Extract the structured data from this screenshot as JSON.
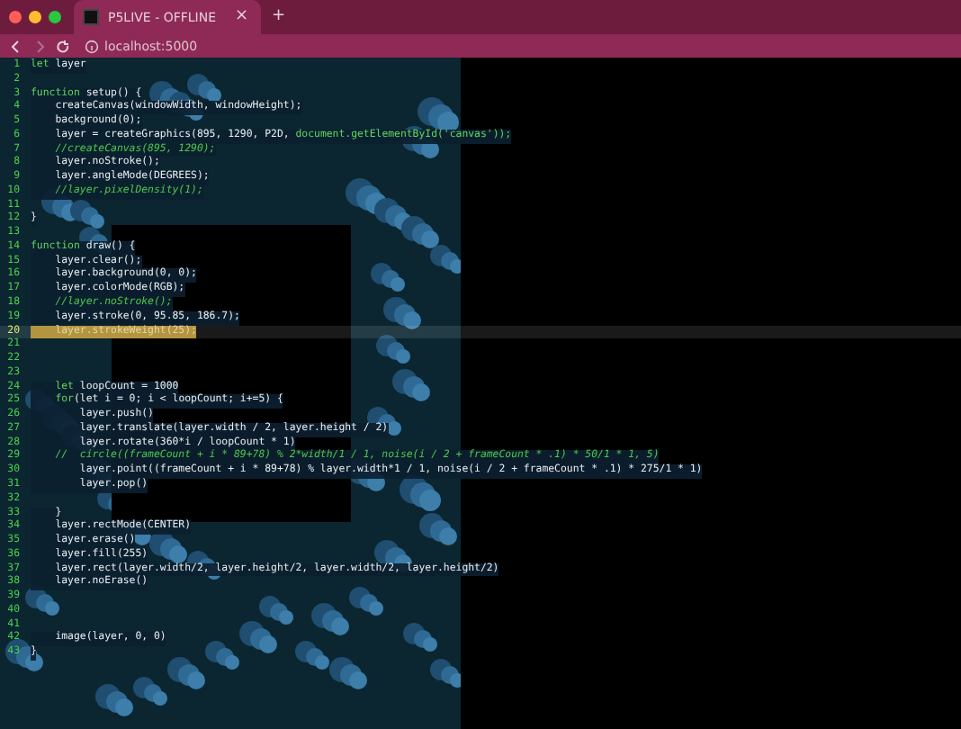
{
  "tabs": [
    {
      "title": "P5LIVE - OFFLINE",
      "selected": true,
      "close": "×"
    }
  ],
  "new_tab": "+",
  "address_bar": {
    "url": "localhost:5000"
  },
  "editor": {
    "lines": [
      {
        "number": "1",
        "current": false,
        "segments": [
          {
            "text": "let",
            "kind": "keyword"
          },
          {
            "text": " layer",
            "kind": "code"
          }
        ]
      },
      {
        "number": "2",
        "current": false
      },
      {
        "number": "3",
        "current": false,
        "segments": [
          {
            "text": "function",
            "kind": "keyword"
          },
          {
            "text": " setup() {",
            "kind": "code"
          }
        ]
      },
      {
        "number": "4",
        "current": false,
        "segments": [
          {
            "text": "    createCanvas(windowWidth, windowHeight);",
            "kind": "code"
          }
        ]
      },
      {
        "number": "5",
        "current": false,
        "segments": [
          {
            "text": "    background(0);",
            "kind": "code"
          }
        ]
      },
      {
        "number": "6",
        "current": false,
        "segments": [
          {
            "text": "    layer = createGraphics(895, 1290, P2D, ",
            "kind": "code"
          },
          {
            "text": "document.getElementById('canvas'));",
            "kind": "keyword"
          }
        ]
      },
      {
        "number": "7",
        "current": false,
        "segments": [
          {
            "text": "    //createCanvas(895, 1290);",
            "kind": "comment"
          }
        ]
      },
      {
        "number": "8",
        "current": false,
        "segments": [
          {
            "text": "    layer.noStroke();",
            "kind": "code"
          }
        ]
      },
      {
        "number": "9",
        "current": false,
        "segments": [
          {
            "text": "    layer.angleMode(DEGREES);",
            "kind": "code"
          }
        ]
      },
      {
        "number": "10",
        "current": false,
        "segments": [
          {
            "text": "    //layer.pixelDensity(1);",
            "kind": "comment"
          }
        ]
      },
      {
        "number": "11",
        "current": false
      },
      {
        "number": "12",
        "current": false,
        "segments": [
          {
            "text": "}",
            "kind": "code"
          }
        ]
      },
      {
        "number": "13",
        "current": false
      },
      {
        "number": "14",
        "current": false,
        "segments": [
          {
            "text": "function",
            "kind": "keyword"
          },
          {
            "text": " draw() {",
            "kind": "code"
          }
        ]
      },
      {
        "number": "15",
        "current": false,
        "segments": [
          {
            "text": "    layer.clear();",
            "kind": "code"
          }
        ]
      },
      {
        "number": "16",
        "current": false,
        "segments": [
          {
            "text": "    layer.background(0, 0);",
            "kind": "code"
          }
        ]
      },
      {
        "number": "17",
        "current": false,
        "segments": [
          {
            "text": "    layer.colorMode(RGB);",
            "kind": "code"
          }
        ]
      },
      {
        "number": "18",
        "current": false,
        "segments": [
          {
            "text": "    //layer.noStroke();",
            "kind": "comment"
          }
        ]
      },
      {
        "number": "19",
        "current": false,
        "segments": [
          {
            "text": "    layer.stroke(0, 95.85, 186.7);",
            "kind": "code"
          }
        ]
      },
      {
        "number": "20",
        "current": true,
        "segments": [
          {
            "text": "    layer.strokeWeight(25);",
            "kind": "code"
          }
        ]
      },
      {
        "number": "21",
        "current": false
      },
      {
        "number": "22",
        "current": false
      },
      {
        "number": "23",
        "current": false
      },
      {
        "number": "24",
        "current": false,
        "segments": [
          {
            "text": "    let",
            "kind": "keyword"
          },
          {
            "text": " loopCount = 1000",
            "kind": "code"
          }
        ]
      },
      {
        "number": "25",
        "current": false,
        "segments": [
          {
            "text": "    for",
            "kind": "keyword"
          },
          {
            "text": "(let i = 0; i < loopCount; i+=5) {",
            "kind": "code"
          }
        ]
      },
      {
        "number": "26",
        "current": false,
        "segments": [
          {
            "text": "        layer.push()",
            "kind": "code"
          }
        ]
      },
      {
        "number": "27",
        "current": false,
        "segments": [
          {
            "text": "        layer.translate(layer.width / 2, layer.height / 2)",
            "kind": "code"
          }
        ]
      },
      {
        "number": "28",
        "current": false,
        "segments": [
          {
            "text": "        layer.rotate(360*i / loopCount * 1)",
            "kind": "code"
          }
        ]
      },
      {
        "number": "29",
        "current": false,
        "segments": [
          {
            "text": "    //  circle((frameCount + i * 89+78) % 2*width/1 / 1, noise(i / 2 + frameCount * .1) * 50/1 * 1, 5)",
            "kind": "comment"
          }
        ]
      },
      {
        "number": "30",
        "current": false,
        "segments": [
          {
            "text": "        layer.point((frameCount + i * 89+78) % layer.width*1 / 1, noise(i / 2 + frameCount * .1) * 275/1 * 1)",
            "kind": "code"
          }
        ]
      },
      {
        "number": "31",
        "current": false,
        "segments": [
          {
            "text": "        layer.pop()",
            "kind": "code"
          }
        ]
      },
      {
        "number": "32",
        "current": false
      },
      {
        "number": "33",
        "current": false,
        "segments": [
          {
            "text": "    }",
            "kind": "code"
          }
        ]
      },
      {
        "number": "34",
        "current": false,
        "segments": [
          {
            "text": "    layer.rectMode(CENTER)",
            "kind": "code"
          }
        ]
      },
      {
        "number": "35",
        "current": false,
        "segments": [
          {
            "text": "    layer.erase()",
            "kind": "code"
          }
        ]
      },
      {
        "number": "36",
        "current": false,
        "segments": [
          {
            "text": "    layer.fill(255)",
            "kind": "code"
          }
        ]
      },
      {
        "number": "37",
        "current": false,
        "segments": [
          {
            "text": "    layer.rect(layer.width/2, layer.height/2, layer.width/2, layer.height/2)",
            "kind": "code"
          }
        ]
      },
      {
        "number": "38",
        "current": false,
        "segments": [
          {
            "text": "    layer.noErase()",
            "kind": "code"
          }
        ]
      },
      {
        "number": "39",
        "current": false
      },
      {
        "number": "40",
        "current": false
      },
      {
        "number": "41",
        "current": false
      },
      {
        "number": "42",
        "current": false,
        "segments": [
          {
            "text": "    image(layer, 0, 0)",
            "kind": "code"
          }
        ]
      },
      {
        "number": "43",
        "current": false,
        "segments": [
          {
            "text": "}",
            "kind": "code"
          }
        ]
      }
    ]
  }
}
